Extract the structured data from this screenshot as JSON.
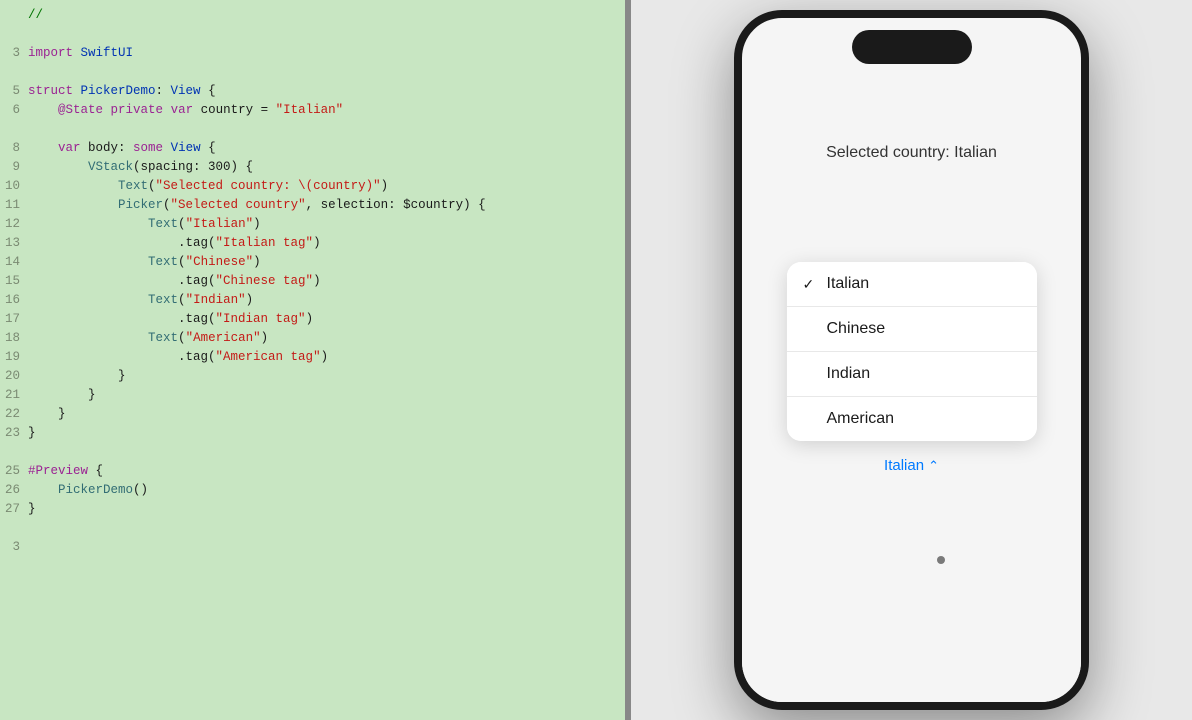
{
  "code_panel": {
    "lines": [
      {
        "num": "",
        "content": "//",
        "tokens": [
          {
            "text": "//",
            "class": "comment"
          }
        ]
      },
      {
        "num": "",
        "content": "",
        "tokens": []
      },
      {
        "num": "3",
        "content": "import SwiftUI",
        "tokens": [
          {
            "text": "import",
            "class": "kw"
          },
          {
            "text": " SwiftUI",
            "class": "type"
          }
        ]
      },
      {
        "num": "",
        "content": "",
        "tokens": []
      },
      {
        "num": "5",
        "content": "struct PickerDemo: View {",
        "tokens": [
          {
            "text": "struct",
            "class": "kw"
          },
          {
            "text": " PickerDemo",
            "class": "type"
          },
          {
            "text": ": ",
            "class": ""
          },
          {
            "text": "View",
            "class": "type"
          },
          {
            "text": " {",
            "class": ""
          }
        ]
      },
      {
        "num": "6",
        "content": "    @State private var country = \"Italian\"",
        "tokens": [
          {
            "text": "    ",
            "class": ""
          },
          {
            "text": "@State",
            "class": "kw"
          },
          {
            "text": " ",
            "class": ""
          },
          {
            "text": "private",
            "class": "kw"
          },
          {
            "text": " ",
            "class": ""
          },
          {
            "text": "var",
            "class": "kw"
          },
          {
            "text": " country = ",
            "class": ""
          },
          {
            "text": "\"Italian\"",
            "class": "str"
          }
        ]
      },
      {
        "num": "",
        "content": "",
        "tokens": []
      },
      {
        "num": "8",
        "content": "    var body: some View {",
        "tokens": [
          {
            "text": "    ",
            "class": ""
          },
          {
            "text": "var",
            "class": "kw"
          },
          {
            "text": " body: ",
            "class": ""
          },
          {
            "text": "some",
            "class": "kw"
          },
          {
            "text": " ",
            "class": ""
          },
          {
            "text": "View",
            "class": "type"
          },
          {
            "text": " {",
            "class": ""
          }
        ]
      },
      {
        "num": "9",
        "content": "        VStack(spacing: 300) {",
        "tokens": [
          {
            "text": "        ",
            "class": ""
          },
          {
            "text": "VStack",
            "class": "func-name"
          },
          {
            "text": "(spacing: 300) {",
            "class": ""
          }
        ]
      },
      {
        "num": "10",
        "content": "            Text(\"Selected country: \\(country)\")",
        "tokens": [
          {
            "text": "            ",
            "class": ""
          },
          {
            "text": "Text",
            "class": "func-name"
          },
          {
            "text": "(",
            "class": ""
          },
          {
            "text": "\"Selected country: \\(country)\"",
            "class": "str"
          },
          {
            "text": ")",
            "class": ""
          }
        ]
      },
      {
        "num": "11",
        "content": "            Picker(\"Selected country\", selection: $country) {",
        "tokens": [
          {
            "text": "            ",
            "class": ""
          },
          {
            "text": "Picker",
            "class": "func-name"
          },
          {
            "text": "(",
            "class": ""
          },
          {
            "text": "\"Selected country\"",
            "class": "str"
          },
          {
            "text": ", selection: $country) {",
            "class": ""
          }
        ]
      },
      {
        "num": "12",
        "content": "                Text(\"Italian\")",
        "tokens": [
          {
            "text": "                ",
            "class": ""
          },
          {
            "text": "Text",
            "class": "func-name"
          },
          {
            "text": "(",
            "class": ""
          },
          {
            "text": "\"Italian\"",
            "class": "str"
          },
          {
            "text": ")",
            "class": ""
          }
        ]
      },
      {
        "num": "13",
        "content": "                    .tag(\"Italian tag\")",
        "tokens": [
          {
            "text": "                    ",
            "class": ""
          },
          {
            "text": ".tag(",
            "class": ""
          },
          {
            "text": "\"Italian tag\"",
            "class": "str"
          },
          {
            "text": ")",
            "class": ""
          }
        ]
      },
      {
        "num": "14",
        "content": "                Text(\"Chinese\")",
        "tokens": [
          {
            "text": "                ",
            "class": ""
          },
          {
            "text": "Text",
            "class": "func-name"
          },
          {
            "text": "(",
            "class": ""
          },
          {
            "text": "\"Chinese\"",
            "class": "str"
          },
          {
            "text": ")",
            "class": ""
          }
        ]
      },
      {
        "num": "15",
        "content": "                    .tag(\"Chinese tag\")",
        "tokens": [
          {
            "text": "                    ",
            "class": ""
          },
          {
            "text": ".tag(",
            "class": ""
          },
          {
            "text": "\"Chinese tag\"",
            "class": "str"
          },
          {
            "text": ")",
            "class": ""
          }
        ]
      },
      {
        "num": "16",
        "content": "                Text(\"Indian\")",
        "tokens": [
          {
            "text": "                ",
            "class": ""
          },
          {
            "text": "Text",
            "class": "func-name"
          },
          {
            "text": "(",
            "class": ""
          },
          {
            "text": "\"Indian\"",
            "class": "str"
          },
          {
            "text": ")",
            "class": ""
          }
        ]
      },
      {
        "num": "17",
        "content": "                    .tag(\"Indian tag\")",
        "tokens": [
          {
            "text": "                    ",
            "class": ""
          },
          {
            "text": ".tag(",
            "class": ""
          },
          {
            "text": "\"Indian tag\"",
            "class": "str"
          },
          {
            "text": ")",
            "class": ""
          }
        ]
      },
      {
        "num": "18",
        "content": "                Text(\"American\")",
        "tokens": [
          {
            "text": "                ",
            "class": ""
          },
          {
            "text": "Text",
            "class": "func-name"
          },
          {
            "text": "(",
            "class": ""
          },
          {
            "text": "\"American\"",
            "class": "str"
          },
          {
            "text": ")",
            "class": ""
          }
        ]
      },
      {
        "num": "19",
        "content": "                    .tag(\"American tag\")",
        "tokens": [
          {
            "text": "                    ",
            "class": ""
          },
          {
            "text": ".tag(",
            "class": ""
          },
          {
            "text": "\"American tag\"",
            "class": "str"
          },
          {
            "text": ")",
            "class": ""
          }
        ]
      },
      {
        "num": "20",
        "content": "            }",
        "tokens": [
          {
            "text": "            }",
            "class": ""
          }
        ]
      },
      {
        "num": "21",
        "content": "        }",
        "tokens": [
          {
            "text": "        }",
            "class": ""
          }
        ]
      },
      {
        "num": "22",
        "content": "    }",
        "tokens": [
          {
            "text": "    }",
            "class": ""
          }
        ]
      },
      {
        "num": "23",
        "content": "}",
        "tokens": [
          {
            "text": "}",
            "class": ""
          }
        ]
      },
      {
        "num": "",
        "content": "",
        "tokens": []
      },
      {
        "num": "25",
        "content": "#Preview {",
        "tokens": [
          {
            "text": "#Preview",
            "class": "kw"
          },
          {
            "text": " {",
            "class": ""
          }
        ]
      },
      {
        "num": "26",
        "content": "    PickerDemo()",
        "tokens": [
          {
            "text": "    ",
            "class": ""
          },
          {
            "text": "PickerDemo",
            "class": "func-name"
          },
          {
            "text": "()",
            "class": ""
          }
        ]
      },
      {
        "num": "27",
        "content": "}",
        "tokens": [
          {
            "text": "}",
            "class": ""
          }
        ]
      },
      {
        "num": "",
        "content": "",
        "tokens": []
      },
      {
        "num": "3",
        "content": "",
        "tokens": []
      }
    ]
  },
  "preview": {
    "selected_country_label": "Selected country: Italian",
    "picker_items": [
      {
        "label": "Italian",
        "selected": true
      },
      {
        "label": "Chinese",
        "selected": false
      },
      {
        "label": "Indian",
        "selected": false
      },
      {
        "label": "American",
        "selected": false
      }
    ],
    "picker_button_label": "Italian",
    "picker_button_chevron": "⌃"
  }
}
